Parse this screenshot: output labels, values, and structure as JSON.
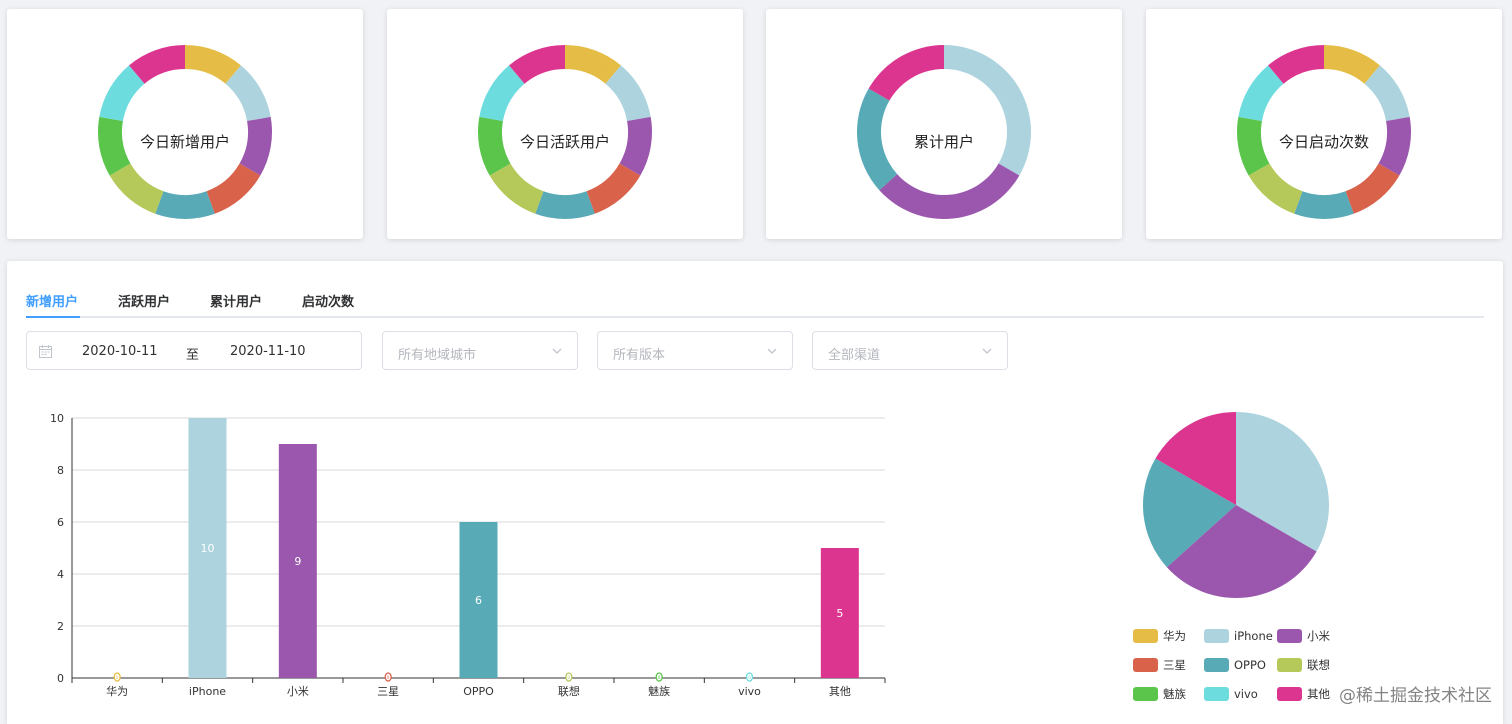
{
  "donuts": [
    {
      "label": "今日新增用户",
      "values": [
        1,
        1,
        1,
        1,
        1,
        1,
        1,
        1,
        1
      ]
    },
    {
      "label": "今日活跃用户",
      "values": [
        1,
        1,
        1,
        1,
        1,
        1,
        1,
        1,
        1
      ]
    },
    {
      "label": "累计用户",
      "values": [
        0,
        10,
        9,
        0,
        6,
        0,
        0,
        0,
        5
      ]
    },
    {
      "label": "今日启动次数",
      "values": [
        1,
        1,
        1,
        1,
        1,
        1,
        1,
        1,
        1
      ]
    }
  ],
  "brands": [
    "华为",
    "iPhone",
    "小米",
    "三星",
    "OPPO",
    "联想",
    "魅族",
    "vivo",
    "其他"
  ],
  "colors": {
    "华为": "#e5bd46",
    "iPhone": "#acd3de",
    "小米": "#9b56ad",
    "三星": "#d9624b",
    "OPPO": "#57aab6",
    "联想": "#b4c95a",
    "魅族": "#5ac54a",
    "vivo": "#6cdcdf",
    "其他": "#dc3590",
    "accent": "#409eff"
  },
  "tabs": [
    {
      "label": "新增用户",
      "active": true
    },
    {
      "label": "活跃用户",
      "active": false
    },
    {
      "label": "累计用户",
      "active": false
    },
    {
      "label": "启动次数",
      "active": false
    }
  ],
  "filters": {
    "date_start": "2020-10-11",
    "date_sep": "至",
    "date_end": "2020-11-10",
    "region_placeholder": "所有地域城市",
    "version_placeholder": "所有版本",
    "channel_placeholder": "全部渠道"
  },
  "chart_data": [
    {
      "type": "bar",
      "categories": [
        "华为",
        "iPhone",
        "小米",
        "三星",
        "OPPO",
        "联想",
        "魅族",
        "vivo",
        "其他"
      ],
      "values": [
        0,
        10,
        9,
        0,
        6,
        0,
        0,
        0,
        5
      ],
      "yticks": [
        0,
        2,
        4,
        6,
        8,
        10
      ],
      "ylim": [
        0,
        10
      ],
      "grid": true
    },
    {
      "type": "pie",
      "labels": [
        "华为",
        "iPhone",
        "小米",
        "三星",
        "OPPO",
        "联想",
        "魅族",
        "vivo",
        "其他"
      ],
      "values": [
        0,
        10,
        9,
        0,
        6,
        0,
        0,
        0,
        5
      ],
      "legend_position": "bottom"
    }
  ],
  "watermark": "@稀土掘金技术社区"
}
